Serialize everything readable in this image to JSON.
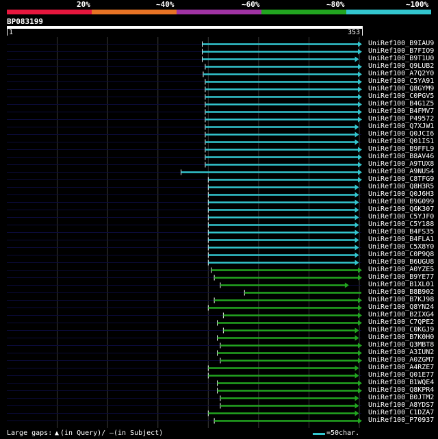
{
  "scale": {
    "labels": [
      "20%",
      "~40%",
      "~60%",
      "~80%",
      "~100%"
    ],
    "colors": [
      "#e6173e",
      "#e87325",
      "#a033a3",
      "#22a520",
      "#33c6cf"
    ]
  },
  "query": {
    "name": "BP083199",
    "start": "1",
    "end": "353",
    "length": 353
  },
  "hits": [
    {
      "name": "UniRef100_B9IAU9",
      "start": 195,
      "end": 353,
      "color": "#33c6cf",
      "arrow": true
    },
    {
      "name": "UniRef100_B7FIO9",
      "start": 195,
      "end": 353,
      "color": "#33c6cf",
      "arrow": true
    },
    {
      "name": "UniRef100_B9T1U0",
      "start": 195,
      "end": 350,
      "color": "#33c6cf",
      "arrow": true
    },
    {
      "name": "UniRef100_Q9LUB2",
      "start": 198,
      "end": 353,
      "color": "#33c6cf",
      "arrow": true
    },
    {
      "name": "UniRef100_A7Q2Y0",
      "start": 196,
      "end": 353,
      "color": "#33c6cf",
      "arrow": true
    },
    {
      "name": "UniRef100_C5YA91",
      "start": 198,
      "end": 353,
      "color": "#33c6cf",
      "arrow": true
    },
    {
      "name": "UniRef100_Q8GYM9",
      "start": 198,
      "end": 353,
      "color": "#33c6cf",
      "arrow": true
    },
    {
      "name": "UniRef100_C0PGV5",
      "start": 198,
      "end": 353,
      "color": "#33c6cf",
      "arrow": true
    },
    {
      "name": "UniRef100_B4G1Z5",
      "start": 198,
      "end": 353,
      "color": "#33c6cf",
      "arrow": true
    },
    {
      "name": "UniRef100_B4FMV7",
      "start": 198,
      "end": 353,
      "color": "#33c6cf",
      "arrow": true
    },
    {
      "name": "UniRef100_P49572",
      "start": 198,
      "end": 353,
      "color": "#33c6cf",
      "arrow": true
    },
    {
      "name": "UniRef100_Q7XJW1",
      "start": 198,
      "end": 350,
      "color": "#33c6cf",
      "arrow": true
    },
    {
      "name": "UniRef100_Q0JCI6",
      "start": 198,
      "end": 350,
      "color": "#33c6cf",
      "arrow": true
    },
    {
      "name": "UniRef100_Q01IS1",
      "start": 198,
      "end": 350,
      "color": "#33c6cf",
      "arrow": true
    },
    {
      "name": "UniRef100_B9FFL9",
      "start": 198,
      "end": 353,
      "color": "#33c6cf",
      "arrow": true
    },
    {
      "name": "UniRef100_B8AV46",
      "start": 198,
      "end": 353,
      "color": "#33c6cf",
      "arrow": true
    },
    {
      "name": "UniRef100_A9TUX8",
      "start": 198,
      "end": 353,
      "color": "#33c6cf",
      "arrow": true
    },
    {
      "name": "UniRef100_A9NUS4",
      "start": 174,
      "end": 353,
      "color": "#33c6cf",
      "arrow": true
    },
    {
      "name": "UniRef100_C8TFG9",
      "start": 201,
      "end": 353,
      "color": "#33c6cf",
      "arrow": true
    },
    {
      "name": "UniRef100_Q8H3R5",
      "start": 201,
      "end": 350,
      "color": "#33c6cf",
      "arrow": true
    },
    {
      "name": "UniRef100_Q0J6H3",
      "start": 201,
      "end": 350,
      "color": "#33c6cf",
      "arrow": true
    },
    {
      "name": "UniRef100_B9G099",
      "start": 201,
      "end": 350,
      "color": "#33c6cf",
      "arrow": true
    },
    {
      "name": "UniRef100_Q6K307",
      "start": 201,
      "end": 350,
      "color": "#33c6cf",
      "arrow": true
    },
    {
      "name": "UniRef100_C5YJF0",
      "start": 201,
      "end": 350,
      "color": "#33c6cf",
      "arrow": true
    },
    {
      "name": "UniRef100_C5Y188",
      "start": 201,
      "end": 350,
      "color": "#33c6cf",
      "arrow": true
    },
    {
      "name": "UniRef100_B4FS35",
      "start": 201,
      "end": 350,
      "color": "#33c6cf",
      "arrow": true
    },
    {
      "name": "UniRef100_B4FLA1",
      "start": 201,
      "end": 350,
      "color": "#33c6cf",
      "arrow": true
    },
    {
      "name": "UniRef100_C5X8Y0",
      "start": 201,
      "end": 350,
      "color": "#33c6cf",
      "arrow": true
    },
    {
      "name": "UniRef100_C0P9Q8",
      "start": 201,
      "end": 350,
      "color": "#33c6cf",
      "arrow": true
    },
    {
      "name": "UniRef100_B6UGU8",
      "start": 201,
      "end": 350,
      "color": "#33c6cf",
      "arrow": true
    },
    {
      "name": "UniRef100_A0YZE5",
      "start": 204,
      "end": 353,
      "color": "#22a520",
      "arrow": true
    },
    {
      "name": "UniRef100_B9YE77",
      "start": 207,
      "end": 353,
      "color": "#22a520",
      "arrow": true
    },
    {
      "name": "UniRef100_B1XL01",
      "start": 213,
      "end": 340,
      "color": "#22a520",
      "arrow": true
    },
    {
      "name": "UniRef100_B8B902",
      "start": 237,
      "end": 353,
      "color": "#22a520",
      "arrow": false
    },
    {
      "name": "UniRef100_B7KJ98",
      "start": 207,
      "end": 353,
      "color": "#22a520",
      "arrow": true
    },
    {
      "name": "UniRef100_Q8YN24",
      "start": 201,
      "end": 353,
      "color": "#22a520",
      "arrow": true
    },
    {
      "name": "UniRef100_B2IXG4",
      "start": 216,
      "end": 353,
      "color": "#22a520",
      "arrow": true
    },
    {
      "name": "UniRef100_C7QPE2",
      "start": 210,
      "end": 353,
      "color": "#22a520",
      "arrow": true
    },
    {
      "name": "UniRef100_C0KGJ9",
      "start": 216,
      "end": 350,
      "color": "#22a520",
      "arrow": true
    },
    {
      "name": "UniRef100_B7K0H0",
      "start": 210,
      "end": 350,
      "color": "#22a520",
      "arrow": true
    },
    {
      "name": "UniRef100_Q3MBT8",
      "start": 213,
      "end": 353,
      "color": "#22a520",
      "arrow": true
    },
    {
      "name": "UniRef100_A3IUN2",
      "start": 210,
      "end": 353,
      "color": "#22a520",
      "arrow": true
    },
    {
      "name": "UniRef100_A0ZGM7",
      "start": 213,
      "end": 353,
      "color": "#22a520",
      "arrow": true
    },
    {
      "name": "UniRef100_A4RZE7",
      "start": 201,
      "end": 350,
      "color": "#22a520",
      "arrow": true
    },
    {
      "name": "UniRef100_Q01E77",
      "start": 201,
      "end": 350,
      "color": "#22a520",
      "arrow": true
    },
    {
      "name": "UniRef100_B1WQE4",
      "start": 210,
      "end": 353,
      "color": "#22a520",
      "arrow": true
    },
    {
      "name": "UniRef100_Q8KPR4",
      "start": 210,
      "end": 353,
      "color": "#22a520",
      "arrow": true
    },
    {
      "name": "UniRef100_B0JTM2",
      "start": 213,
      "end": 350,
      "color": "#22a520",
      "arrow": true
    },
    {
      "name": "UniRef100_A8YDS7",
      "start": 213,
      "end": 350,
      "color": "#22a520",
      "arrow": true
    },
    {
      "name": "UniRef100_C1DZA7",
      "start": 201,
      "end": 350,
      "color": "#22a520",
      "arrow": true
    },
    {
      "name": "UniRef100_P70937",
      "start": 207,
      "end": 353,
      "color": "#22a520",
      "arrow": true
    }
  ],
  "legend": {
    "gaps_label": "Large gaps:",
    "query_gap_marker": "▲",
    "query_gap_text": "(in Query)/",
    "subject_gap_marker": "—",
    "subject_gap_text": " (in Subject)",
    "scale_text": "=50char."
  },
  "colors": {
    "underlay": "#0b0b3a",
    "grid": "#3a3a3a"
  }
}
